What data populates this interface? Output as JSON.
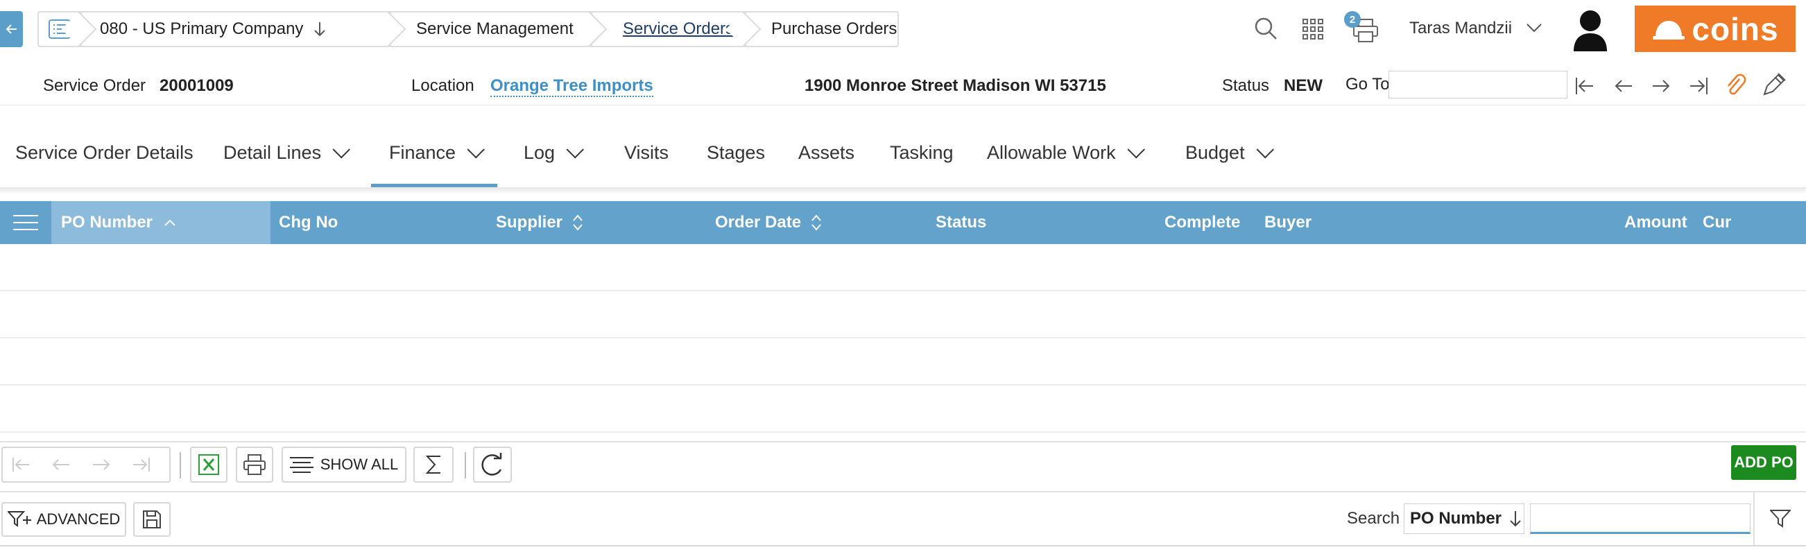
{
  "breadcrumbs": {
    "company": "080 - US Primary Company",
    "service_management": "Service Management",
    "service_orders": "Service Orders",
    "purchase_orders": "Purchase Orders"
  },
  "header": {
    "print_badge": "2",
    "user_name": "Taras Mandzii",
    "logo_text": "coins"
  },
  "info": {
    "service_order_label": "Service Order",
    "service_order_value": "20001009",
    "location_label": "Location",
    "location_value": "Orange Tree Imports",
    "address": "1900 Monroe Street Madison WI 53715",
    "status_label": "Status",
    "status_value": "NEW",
    "goto_label": "Go To",
    "goto_value": ""
  },
  "tabs": [
    {
      "label": "Service Order Details",
      "dropdown": false
    },
    {
      "label": "Detail Lines",
      "dropdown": true
    },
    {
      "label": "Finance",
      "dropdown": true,
      "active": true
    },
    {
      "label": "Log",
      "dropdown": true
    },
    {
      "label": "Visits",
      "dropdown": false
    },
    {
      "label": "Stages",
      "dropdown": false
    },
    {
      "label": "Assets",
      "dropdown": false
    },
    {
      "label": "Tasking",
      "dropdown": false
    },
    {
      "label": "Allowable Work",
      "dropdown": true
    },
    {
      "label": "Budget",
      "dropdown": true
    }
  ],
  "grid": {
    "columns": [
      "PO Number",
      "Chg No",
      "Supplier",
      "Order Date",
      "Status",
      "Complete",
      "Buyer",
      "Amount",
      "Cur"
    ],
    "rows": []
  },
  "toolbar": {
    "show_all": "SHOW ALL",
    "add_po": "ADD PO"
  },
  "search": {
    "advanced": "ADVANCED",
    "label": "Search",
    "field": "PO Number",
    "value": ""
  },
  "colors": {
    "accent": "#5b9ec9",
    "grid_header": "#62a2cb",
    "sorted_header": "#8cbbdc",
    "logo": "#ef7a27",
    "add_button": "#1b8a1f"
  }
}
